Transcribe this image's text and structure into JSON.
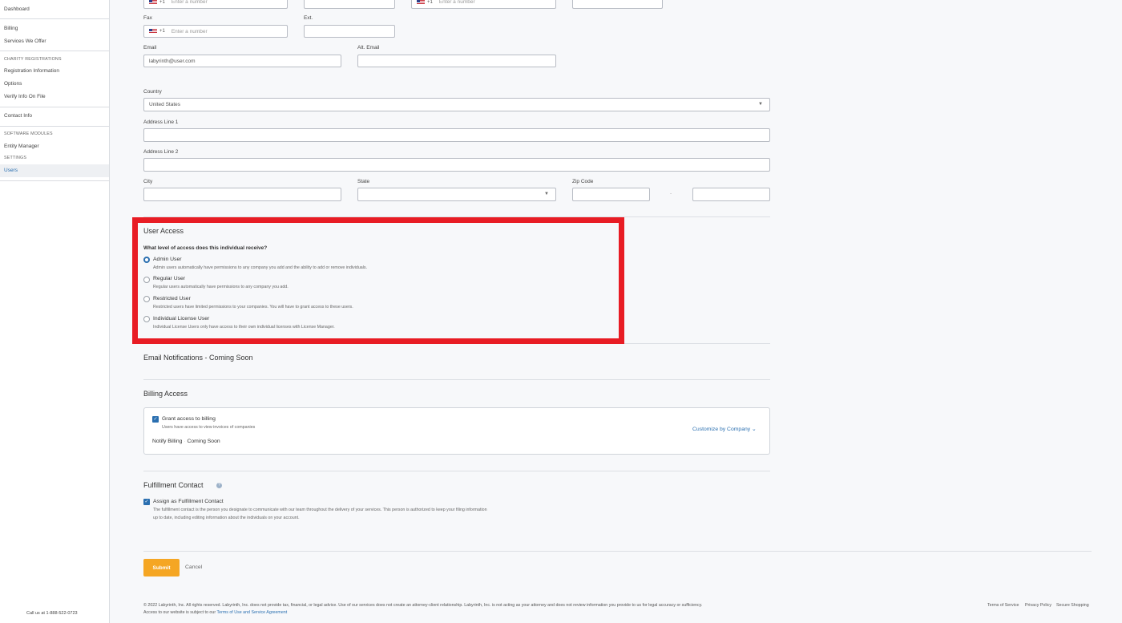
{
  "sidebar": {
    "items": [
      {
        "label": "Dashboard"
      },
      {
        "label": "Billing"
      },
      {
        "label": "Services We Offer"
      },
      {
        "label": "Registration Information"
      },
      {
        "label": "Options"
      },
      {
        "label": "Verify Info On File"
      },
      {
        "label": "Contact Info"
      },
      {
        "label": "Entity Manager"
      },
      {
        "label": "Users"
      }
    ],
    "headings": [
      "CHARITY REGISTRATIONS",
      "SOFTWARE MODULES",
      "SETTINGS"
    ],
    "call_us": "Call us at 1-888-522-0723"
  },
  "phone": {
    "country_code": "+1",
    "placeholder": "Enter a number"
  },
  "form": {
    "fax_label": "Fax",
    "ext_label": "Ext.",
    "email_label": "Email",
    "email_value": "labyrinth@user.com",
    "alt_email_label": "Alt. Email",
    "country_label": "Country",
    "country_value": "United States",
    "address1_label": "Address Line 1",
    "address2_label": "Address Line 2",
    "city_label": "City",
    "state_label": "State",
    "zip_label": "Zip Code",
    "zip_separator": "-"
  },
  "user_access": {
    "title": "User Access",
    "question": "What level of access does this individual receive?",
    "options": [
      {
        "label": "Admin User",
        "desc": "Admin users automatically have permissions to any company you add and the ability to add or remove individuals."
      },
      {
        "label": "Regular User",
        "desc": "Regular users automatically have permissions to any company you add."
      },
      {
        "label": "Restricted User",
        "desc": "Restricted users have limited permissions to your companies. You will have to grant access to these users."
      },
      {
        "label": "Individual License User",
        "desc": "Individual License Users only have access to their own individual licenses with License Manager."
      }
    ],
    "selected": "Admin User"
  },
  "email_notifications": {
    "title": "Email Notifications - Coming Soon"
  },
  "billing_access": {
    "title": "Billing Access",
    "grant_label": "Grant access to billing",
    "grant_desc": "Users have access to view invoices of companies",
    "customize_label": "Customize by Company",
    "notify_label": "Notify Billing",
    "notify_status": "Coming Soon"
  },
  "fulfillment": {
    "title": "Fulfillment Contact",
    "assign_label": "Assign as Fulfillment Contact",
    "desc_line1": "The fulfillment contact is the person you designate to communicate with our team throughout the delivery of your services. This person is authorized to keep your filing information",
    "desc_line2": "up to date, including editing information about the individuals on your account."
  },
  "actions": {
    "submit": "Submit",
    "cancel": "Cancel"
  },
  "footer": {
    "line1": "© 2022 Labyrinth, Inc. All rights reserved. Labyrinth, Inc. does not provide tax, financial, or legal advice. Use of our services does not create an attorney-client relationship. Labyrinth, Inc. is not acting as your attorney and does not review information you provide to us for legal accuracy or sufficiency.",
    "line2_prefix": "Access to our website is subject to our ",
    "line2_link": "Terms of Use and Service Agreement",
    "links": [
      "Terms of Service",
      "Privacy Policy",
      "Secure Shopping"
    ]
  },
  "colors": {
    "accent": "#2a6fb0",
    "highlight": "#e81c24",
    "submit": "#f5a623"
  }
}
